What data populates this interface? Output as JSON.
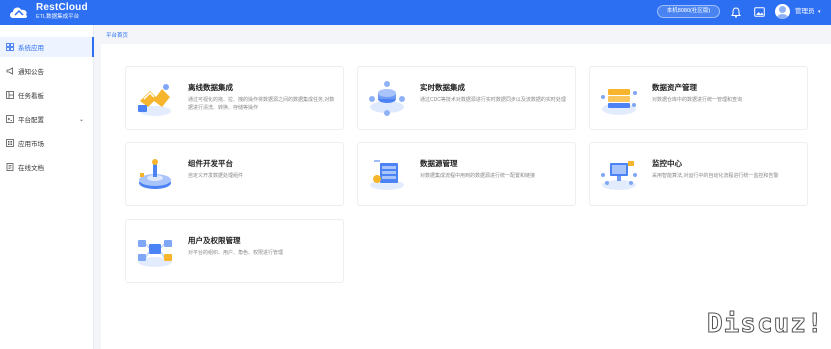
{
  "header": {
    "brand_name": "RestCloud",
    "brand_subtitle": "ETL数据集成平台",
    "env_label": "本机8080(社区版)",
    "user_name": "管理员",
    "colors": {
      "primary": "#2d6ff2"
    }
  },
  "sidebar": {
    "items": [
      {
        "label": "系统应用",
        "icon": "grid-icon",
        "active": true
      },
      {
        "label": "通知公告",
        "icon": "megaphone-icon"
      },
      {
        "label": "任务看板",
        "icon": "board-icon"
      },
      {
        "label": "平台配置",
        "icon": "settings-panel-icon",
        "has_children": true
      },
      {
        "label": "应用市场",
        "icon": "store-icon"
      },
      {
        "label": "在线文档",
        "icon": "document-icon"
      }
    ]
  },
  "breadcrumb": "平台首页",
  "cards": [
    {
      "title": "离线数据集成",
      "desc": "通过可视化的拖、拉、拽的操作将数据源之间的数据集成任务,对数据进行清洗、转换、存储等操作",
      "icon": "offline-integration-icon"
    },
    {
      "title": "实时数据集成",
      "desc": "通过CDC等技术对数据源进行实时数据同步以及流数据的实时处理",
      "icon": "realtime-integration-icon"
    },
    {
      "title": "数据资产管理",
      "desc": "对数据仓库中的数据进行统一管理和查询",
      "icon": "data-asset-icon"
    },
    {
      "title": "组件开发平台",
      "desc": "自定义开发数据处理组件",
      "icon": "component-dev-icon"
    },
    {
      "title": "数据源管理",
      "desc": "对数据集成流程中用到的数据源进行统一配置和链接",
      "icon": "datasource-icon"
    },
    {
      "title": "监控中心",
      "desc": "采用智能算法,对运行中的自动化流程进行统一监控和告警",
      "icon": "monitor-icon"
    },
    {
      "title": "用户及权限管理",
      "desc": "对平台的组织、用户、角色、权限进行管理",
      "icon": "user-permission-icon"
    }
  ],
  "watermark": "Discuz!"
}
